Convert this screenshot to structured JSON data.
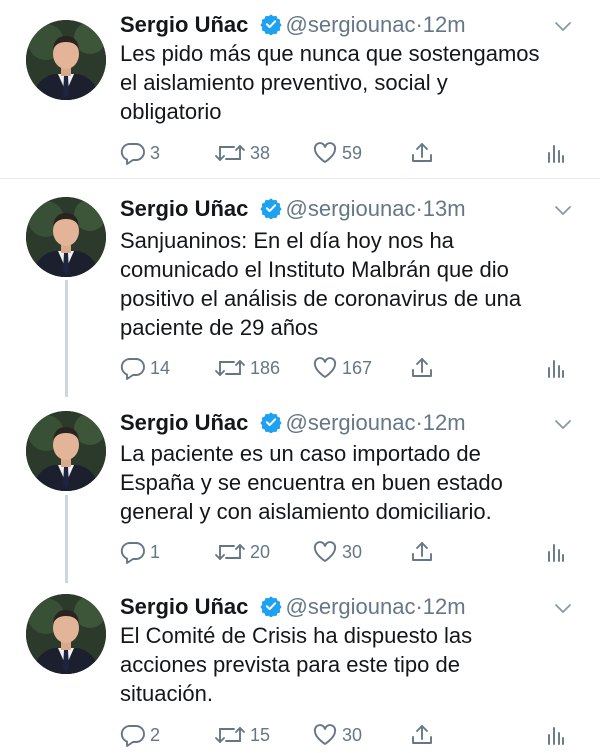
{
  "tweets": [
    {
      "name": "Sergio Uñac",
      "handle": "@sergiounac",
      "separator": "·",
      "time": "12m",
      "text": "Les pido más que nunca que sostengamos\nel aislamiento preventivo, social y\nobligatorio",
      "replies": "3",
      "retweets": "38",
      "likes": "59"
    },
    {
      "name": "Sergio Uñac",
      "handle": "@sergiounac",
      "separator": "·",
      "time": "13m",
      "text": "Sanjuaninos: En el día hoy nos ha\ncomunicado el Instituto Malbrán que dio\npositivo el análisis de coronavirus de una\npaciente de 29 años",
      "replies": "14",
      "retweets": "186",
      "likes": "167"
    },
    {
      "name": "Sergio Uñac",
      "handle": "@sergiounac",
      "separator": "·",
      "time": "12m",
      "text": "La paciente es un caso importado de\nEspaña y se encuentra en buen estado\ngeneral y con aislamiento domiciliario.",
      "replies": "1",
      "retweets": "20",
      "likes": "30"
    },
    {
      "name": "Sergio Uñac",
      "handle": "@sergiounac",
      "separator": "·",
      "time": "12m",
      "text": "El Comité de Crisis ha dispuesto las\nacciones prevista para este tipo de\nsituación.",
      "replies": "2",
      "retweets": "15",
      "likes": "30"
    }
  ],
  "icons": {
    "verified": "verified-badge-icon",
    "reply": "reply-icon",
    "retweet": "retweet-icon",
    "like": "heart-icon",
    "share": "share-icon",
    "analytics": "analytics-icon",
    "more": "chevron-down-icon"
  },
  "colors": {
    "verified": "#1da1f2",
    "icon_gray": "#657786",
    "divider": "#e6ecf0",
    "thread_line": "#ccd6dd"
  }
}
